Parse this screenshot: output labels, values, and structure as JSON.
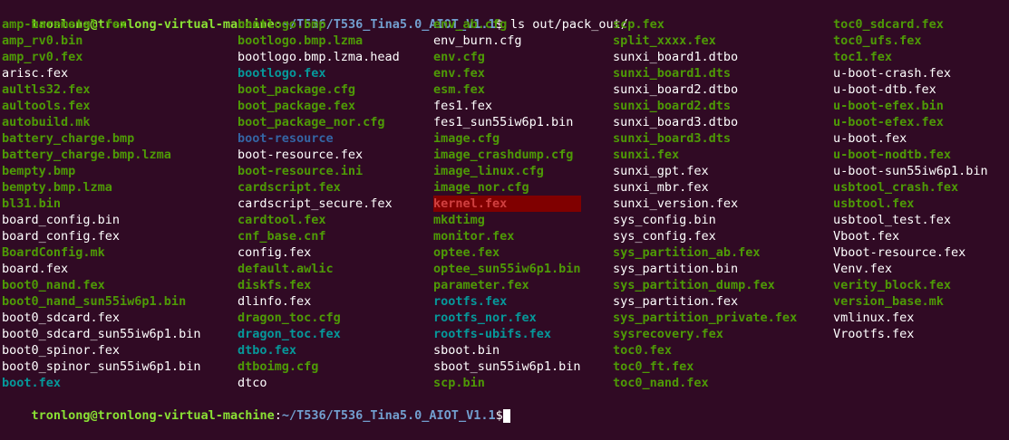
{
  "prompt": {
    "user_host": "tronlong@tronlong-virtual-machine",
    "sep": ":",
    "path": "~/T536/T536_Tina5.0_AIOT_V1.1",
    "symbol": "$",
    "command": " ls out/pack_out/"
  },
  "columns": [
    [
      {
        "name": "amp-baremetal.fex",
        "color": "green"
      },
      {
        "name": "amp_rv0.bin",
        "color": "green"
      },
      {
        "name": "amp_rv0.fex",
        "color": "green"
      },
      {
        "name": "arisc.fex",
        "color": "white"
      },
      {
        "name": "aultls32.fex",
        "color": "green"
      },
      {
        "name": "aultools.fex",
        "color": "green"
      },
      {
        "name": "autobuild.mk",
        "color": "green"
      },
      {
        "name": "battery_charge.bmp",
        "color": "green"
      },
      {
        "name": "battery_charge.bmp.lzma",
        "color": "green"
      },
      {
        "name": "bempty.bmp",
        "color": "green"
      },
      {
        "name": "bempty.bmp.lzma",
        "color": "green"
      },
      {
        "name": "bl31.bin",
        "color": "green"
      },
      {
        "name": "board_config.bin",
        "color": "white"
      },
      {
        "name": "board_config.fex",
        "color": "white"
      },
      {
        "name": "BoardConfig.mk",
        "color": "green"
      },
      {
        "name": "board.fex",
        "color": "white"
      },
      {
        "name": "boot0_nand.fex",
        "color": "green"
      },
      {
        "name": "boot0_nand_sun55iw6p1.bin",
        "color": "green"
      },
      {
        "name": "boot0_sdcard.fex",
        "color": "white"
      },
      {
        "name": "boot0_sdcard_sun55iw6p1.bin",
        "color": "white"
      },
      {
        "name": "boot0_spinor.fex",
        "color": "white"
      },
      {
        "name": "boot0_spinor_sun55iw6p1.bin",
        "color": "white"
      },
      {
        "name": "boot.fex",
        "color": "cyan"
      }
    ],
    [
      {
        "name": "bootlogo.bmp",
        "color": "green"
      },
      {
        "name": "bootlogo.bmp.lzma",
        "color": "green"
      },
      {
        "name": "bootlogo.bmp.lzma.head",
        "color": "white"
      },
      {
        "name": "bootlogo.fex",
        "color": "cyan"
      },
      {
        "name": "boot_package.cfg",
        "color": "green"
      },
      {
        "name": "boot_package.fex",
        "color": "green"
      },
      {
        "name": "boot_package_nor.cfg",
        "color": "green"
      },
      {
        "name": "boot-resource",
        "color": "blue"
      },
      {
        "name": "boot-resource.fex",
        "color": "white"
      },
      {
        "name": "boot-resource.ini",
        "color": "green"
      },
      {
        "name": "cardscript.fex",
        "color": "green"
      },
      {
        "name": "cardscript_secure.fex",
        "color": "white"
      },
      {
        "name": "cardtool.fex",
        "color": "green"
      },
      {
        "name": "cnf_base.cnf",
        "color": "green"
      },
      {
        "name": "config.fex",
        "color": "white"
      },
      {
        "name": "default.awlic",
        "color": "green"
      },
      {
        "name": "diskfs.fex",
        "color": "green"
      },
      {
        "name": "dlinfo.fex",
        "color": "white"
      },
      {
        "name": "dragon_toc.cfg",
        "color": "green"
      },
      {
        "name": "dragon_toc.fex",
        "color": "cyan"
      },
      {
        "name": "dtbo.fex",
        "color": "cyan"
      },
      {
        "name": "dtboimg.cfg",
        "color": "green"
      },
      {
        "name": "dtco",
        "color": "white"
      }
    ],
    [
      {
        "name": "env_ab.cfg",
        "color": "green"
      },
      {
        "name": "env_burn.cfg",
        "color": "white"
      },
      {
        "name": "env.cfg",
        "color": "green"
      },
      {
        "name": "env.fex",
        "color": "green"
      },
      {
        "name": "esm.fex",
        "color": "green"
      },
      {
        "name": "fes1.fex",
        "color": "white"
      },
      {
        "name": "fes1_sun55iw6p1.bin",
        "color": "white"
      },
      {
        "name": "image.cfg",
        "color": "green"
      },
      {
        "name": "image_crashdump.cfg",
        "color": "green"
      },
      {
        "name": "image_linux.cfg",
        "color": "green"
      },
      {
        "name": "image_nor.cfg",
        "color": "green"
      },
      {
        "name": "kernel.fex",
        "color": "red"
      },
      {
        "name": "mkdtimg",
        "color": "green"
      },
      {
        "name": "monitor.fex",
        "color": "green"
      },
      {
        "name": "optee.fex",
        "color": "green"
      },
      {
        "name": "optee_sun55iw6p1.bin",
        "color": "green"
      },
      {
        "name": "parameter.fex",
        "color": "green"
      },
      {
        "name": "rootfs.fex",
        "color": "cyan"
      },
      {
        "name": "rootfs_nor.fex",
        "color": "cyan"
      },
      {
        "name": "rootfs-ubifs.fex",
        "color": "cyan"
      },
      {
        "name": "sboot.bin",
        "color": "white"
      },
      {
        "name": "sboot_sun55iw6p1.bin",
        "color": "white"
      },
      {
        "name": "scp.bin",
        "color": "green"
      }
    ],
    [
      {
        "name": "scp.fex",
        "color": "green"
      },
      {
        "name": "split_xxxx.fex",
        "color": "green"
      },
      {
        "name": "sunxi_board1.dtbo",
        "color": "white"
      },
      {
        "name": "sunxi_board1.dts",
        "color": "green"
      },
      {
        "name": "sunxi_board2.dtbo",
        "color": "white"
      },
      {
        "name": "sunxi_board2.dts",
        "color": "green"
      },
      {
        "name": "sunxi_board3.dtbo",
        "color": "white"
      },
      {
        "name": "sunxi_board3.dts",
        "color": "green"
      },
      {
        "name": "sunxi.fex",
        "color": "green"
      },
      {
        "name": "sunxi_gpt.fex",
        "color": "white"
      },
      {
        "name": "sunxi_mbr.fex",
        "color": "white"
      },
      {
        "name": "sunxi_version.fex",
        "color": "white"
      },
      {
        "name": "sys_config.bin",
        "color": "white"
      },
      {
        "name": "sys_config.fex",
        "color": "white"
      },
      {
        "name": "sys_partition_ab.fex",
        "color": "green"
      },
      {
        "name": "sys_partition.bin",
        "color": "white"
      },
      {
        "name": "sys_partition_dump.fex",
        "color": "green"
      },
      {
        "name": "sys_partition.fex",
        "color": "white"
      },
      {
        "name": "sys_partition_private.fex",
        "color": "green"
      },
      {
        "name": "sysrecovery.fex",
        "color": "green"
      },
      {
        "name": "toc0.fex",
        "color": "green"
      },
      {
        "name": "toc0_ft.fex",
        "color": "green"
      },
      {
        "name": "toc0_nand.fex",
        "color": "green"
      }
    ],
    [
      {
        "name": "toc0_sdcard.fex",
        "color": "green"
      },
      {
        "name": "toc0_ufs.fex",
        "color": "green"
      },
      {
        "name": "toc1.fex",
        "color": "green"
      },
      {
        "name": "u-boot-crash.fex",
        "color": "white"
      },
      {
        "name": "u-boot-dtb.fex",
        "color": "white"
      },
      {
        "name": "u-boot-efex.bin",
        "color": "green"
      },
      {
        "name": "u-boot-efex.fex",
        "color": "green"
      },
      {
        "name": "u-boot.fex",
        "color": "white"
      },
      {
        "name": "u-boot-nodtb.fex",
        "color": "green"
      },
      {
        "name": "u-boot-sun55iw6p1.bin",
        "color": "white"
      },
      {
        "name": "usbtool_crash.fex",
        "color": "green"
      },
      {
        "name": "usbtool.fex",
        "color": "green"
      },
      {
        "name": "usbtool_test.fex",
        "color": "white"
      },
      {
        "name": "Vboot.fex",
        "color": "white"
      },
      {
        "name": "Vboot-resource.fex",
        "color": "white"
      },
      {
        "name": "Venv.fex",
        "color": "white"
      },
      {
        "name": "verity_block.fex",
        "color": "green"
      },
      {
        "name": "version_base.mk",
        "color": "green"
      },
      {
        "name": "vmlinux.fex",
        "color": "white"
      },
      {
        "name": "Vrootfs.fex",
        "color": "white"
      }
    ]
  ],
  "colors": {
    "background": "#300a24",
    "white": "#ffffff",
    "green": "#4e9a06",
    "blue": "#3465a4",
    "cyan": "#06989a",
    "prompt_user": "#8ae234",
    "prompt_path": "#729fcf"
  }
}
